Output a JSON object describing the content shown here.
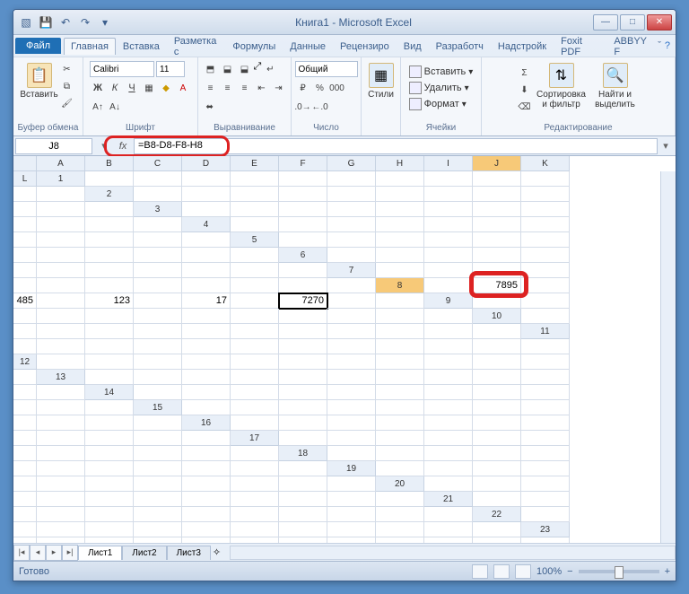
{
  "title": "Книга1 - Microsoft Excel",
  "tabs": {
    "file": "Файл",
    "home": "Главная",
    "insert": "Вставка",
    "layout": "Разметка с",
    "formulas": "Формулы",
    "data": "Данные",
    "review": "Рецензиро",
    "view": "Вид",
    "developer": "Разработч",
    "addins": "Надстройк",
    "foxit": "Foxit PDF",
    "abbyy": "ABBYY F"
  },
  "groups": {
    "clipboard": "Буфер обмена",
    "font": "Шрифт",
    "align": "Выравнивание",
    "number": "Число",
    "styles": "Стили",
    "cells": "Ячейки",
    "editing": "Редактирование"
  },
  "paste": "Вставить",
  "font": {
    "name": "Calibri",
    "size": "11"
  },
  "numfmt": "Общий",
  "styles_btn": "Стили",
  "cells": {
    "insert": "Вставить",
    "delete": "Удалить",
    "format": "Формат"
  },
  "editing": {
    "sort": "Сортировка\nи фильтр",
    "find": "Найти и\nвыделить"
  },
  "namebox": "J8",
  "formula": "=B8-D8-F8-H8",
  "cols": [
    "A",
    "B",
    "C",
    "D",
    "E",
    "F",
    "G",
    "H",
    "I",
    "J",
    "K",
    "L"
  ],
  "rows": 24,
  "values": {
    "B8": "7895",
    "D8": "485",
    "F8": "123",
    "H8": "17",
    "J8": "7270"
  },
  "active_cell": "J8",
  "active_row": 8,
  "active_col": "J",
  "sheets": [
    "Лист1",
    "Лист2",
    "Лист3"
  ],
  "status": "Готово",
  "zoom": "100%"
}
